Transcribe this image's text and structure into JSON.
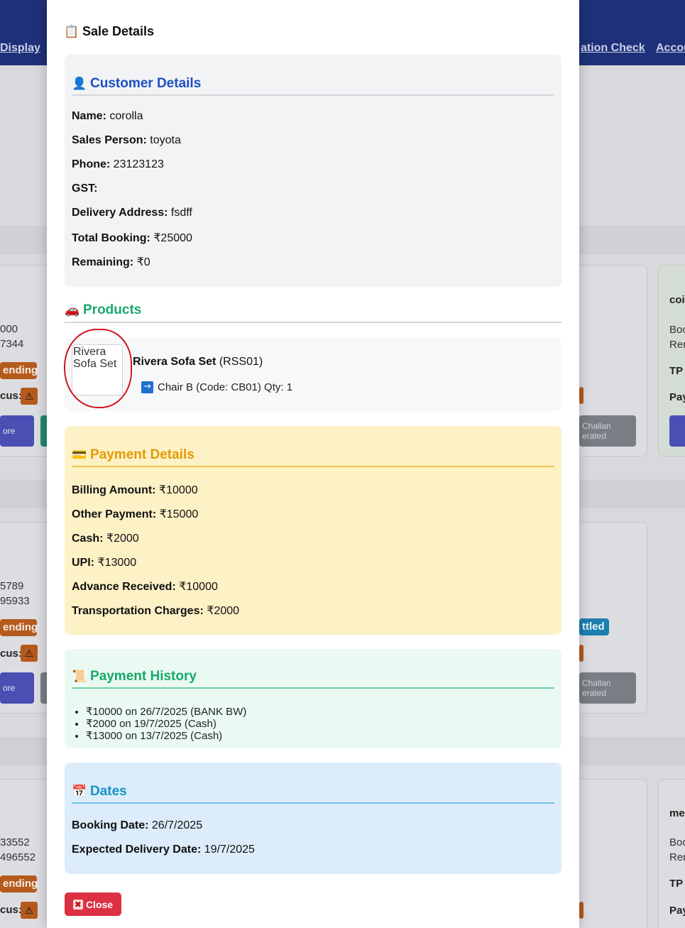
{
  "background": {
    "nav": {
      "links": [
        "Display",
        "ation Check",
        "Accou"
      ]
    },
    "cards": {
      "left_values": [
        "000",
        "7344",
        "5789",
        "95933",
        "33552",
        "496552"
      ],
      "badge_pending": "ending",
      "status_label": "cus:",
      "more_button": "ore",
      "challan_line1": "Challan",
      "challan_line2": "erated",
      "settled_badge": "ttled",
      "right_names": [
        "coi",
        "me"
      ],
      "right_labels": [
        "Boo",
        "Rer",
        "TP",
        "Pay"
      ]
    }
  },
  "modal": {
    "title_icon": "clipboard-icon",
    "title": "Sale Details",
    "customer": {
      "heading_icon": "person-icon",
      "heading": "Customer Details",
      "fields": [
        {
          "label": "Name:",
          "value": "corolla"
        },
        {
          "label": "Sales Person:",
          "value": "toyota"
        },
        {
          "label": "Phone:",
          "value": "23123123"
        },
        {
          "label": "GST:",
          "value": ""
        },
        {
          "label": "Delivery Address:",
          "value": "fsdff"
        },
        {
          "label": "Total Booking:",
          "value": "₹25000"
        },
        {
          "label": "Remaining:",
          "value": "₹0"
        }
      ]
    },
    "products": {
      "heading_icon": "car-icon",
      "heading": "Products",
      "items": [
        {
          "image_alt": "Rivera Sofa Set",
          "name": "Rivera Sofa Set",
          "code": "(RSS01)",
          "sub_item": "Chair B (Code: CB01) Qty: 1"
        }
      ]
    },
    "payment": {
      "heading_icon": "credit-card-icon",
      "heading": "Payment Details",
      "fields": [
        {
          "label": "Billing Amount:",
          "value": "₹10000"
        },
        {
          "label": "Other Payment:",
          "value": "₹15000"
        },
        {
          "label": "Cash:",
          "value": "₹2000"
        },
        {
          "label": "UPI:",
          "value": "₹13000"
        },
        {
          "label": "Advance Received:",
          "value": "₹10000"
        },
        {
          "label": "Transportation Charges:",
          "value": "₹2000"
        }
      ]
    },
    "history": {
      "heading_icon": "scroll-icon",
      "heading": "Payment History",
      "entries": [
        "₹10000 on 26/7/2025 (BANK BW)",
        "₹2000 on 19/7/2025 (Cash)",
        "₹13000 on 13/7/2025 (Cash)"
      ]
    },
    "dates": {
      "heading_icon": "calendar-icon",
      "heading": "Dates",
      "fields": [
        {
          "label": "Booking Date:",
          "value": "26/7/2025"
        },
        {
          "label": "Expected Delivery Date:",
          "value": "19/7/2025"
        }
      ]
    },
    "close_label": "Close"
  },
  "colors": {
    "nav": "#1e3178",
    "customer_heading": "#1d4fc4",
    "products_heading": "#18a86a",
    "payment_heading": "#e49a06",
    "payment_bg": "#fdf1c6",
    "history_bg": "#eafaf2",
    "dates_heading": "#1592c6",
    "dates_bg": "#dcecfa",
    "close_button": "#dc3142",
    "annotation_ring": "#d4141c"
  }
}
